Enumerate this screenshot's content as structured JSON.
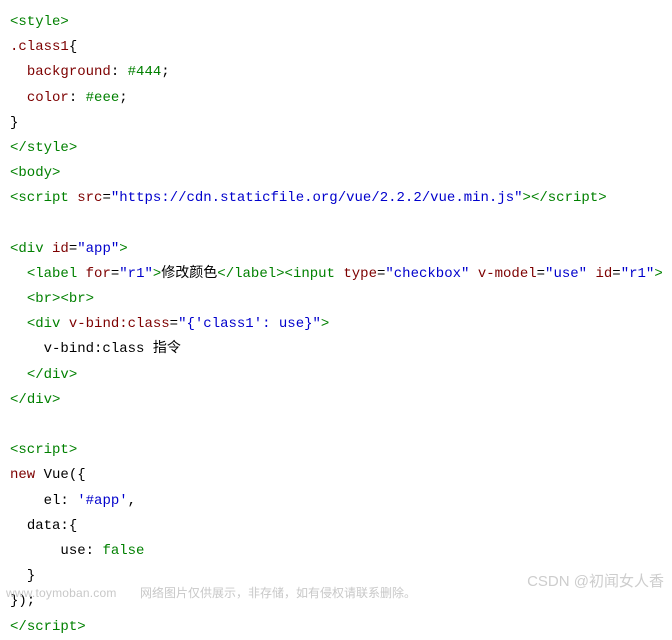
{
  "code": {
    "l1": {
      "open": "<",
      "tag": "style",
      "close": ">"
    },
    "l2": {
      "selector": ".class1",
      "brace": "{"
    },
    "l3": {
      "prop": "background",
      "colon": ": ",
      "val": "#444",
      "semi": ";"
    },
    "l4": {
      "prop": "color",
      "colon": ": ",
      "val": "#eee",
      "semi": ";"
    },
    "l5": {
      "brace": "}"
    },
    "l6": {
      "open": "</",
      "tag": "style",
      "close": ">"
    },
    "l7": {
      "open": "<",
      "tag": "body",
      "close": ">"
    },
    "l8": {
      "open": "<",
      "tag": "script",
      "sp": " ",
      "attr": "src",
      "eq": "=",
      "q": "\"",
      "val": "https://cdn.staticfile.org/vue/2.2.2/vue.min.js",
      "close1": ">",
      "open2": "</",
      "tag2": "script",
      "close2": ">"
    },
    "l9": {
      "blank": ""
    },
    "l10": {
      "open": "<",
      "tag": "div",
      "sp": " ",
      "attr": "id",
      "eq": "=",
      "q": "\"",
      "val": "app",
      "close": ">"
    },
    "l11": {
      "open": "<",
      "tag": "label",
      "sp": " ",
      "attr": "for",
      "eq": "=",
      "q": "\"",
      "val": "r1",
      "close": ">",
      "text": "修改颜色",
      "open2": "</",
      "tag2": "label",
      "close2": ">",
      "open3": "<",
      "tag3": "input",
      "sp3": " ",
      "attr3a": "type",
      "eq3": "=",
      "q3": "\"",
      "val3a": "checkbox",
      "sp3b": " ",
      "attr3b": "v-model",
      "val3b": "use",
      "sp3c": " ",
      "attr3c": "id",
      "val3c": "r1",
      "close3": ">"
    },
    "l12": {
      "open": "<",
      "tag": "br",
      "close": ">",
      "open2": "<",
      "tag2": "br",
      "close2": ">"
    },
    "l13": {
      "open": "<",
      "tag": "div",
      "sp": " ",
      "attr": "v-bind:class",
      "eq": "=",
      "q": "\"",
      "val": "{'class1': use}",
      "close": ">"
    },
    "l14": {
      "text": "v-bind:class 指令"
    },
    "l15": {
      "open": "</",
      "tag": "div",
      "close": ">"
    },
    "l16": {
      "open": "</",
      "tag": "div",
      "close": ">"
    },
    "l17": {
      "blank": ""
    },
    "l18": {
      "open": "<",
      "tag": "script",
      "close": ">"
    },
    "l19": {
      "kw": "new",
      "sp": " ",
      "id": "Vue",
      "paren": "({"
    },
    "l20": {
      "key": "el",
      "colon": ": ",
      "val": "'#app'",
      "comma": ","
    },
    "l21": {
      "key": "data",
      "colon": ":",
      "brace": "{"
    },
    "l22": {
      "key": "use",
      "colon": ": ",
      "val": "false"
    },
    "l23": {
      "brace": "}"
    },
    "l24": {
      "close": "});"
    },
    "l25": {
      "open": "</",
      "tag": "script",
      "close": ">"
    }
  },
  "watermarks": {
    "url": "www.toymoban.com",
    "note": "网络图片仅供展示，非存储，如有侵权请联系删除。",
    "author": "CSDN @初闻女人香"
  }
}
